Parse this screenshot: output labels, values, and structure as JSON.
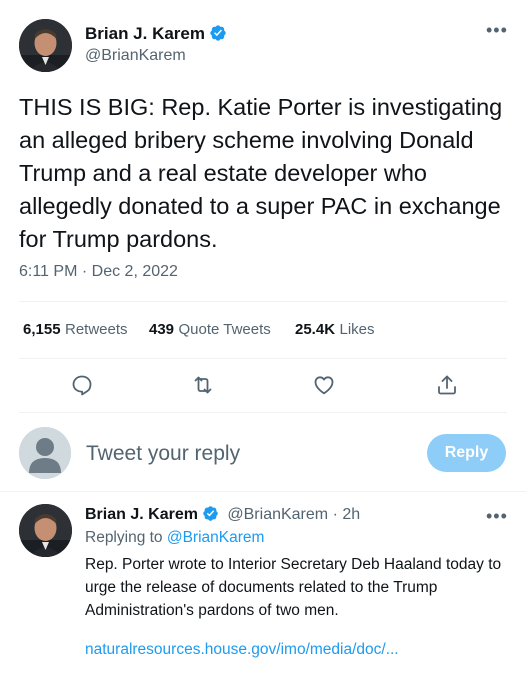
{
  "tweet": {
    "author_name": "Brian J. Karem",
    "author_handle": "@BrianKarem",
    "text": "THIS IS BIG: Rep. Katie Porter is investigating an alleged bribery scheme involving Donald Trump and a real estate developer who allegedly donated to a super PAC in exchange for Trump pardons.",
    "time": "6:11 PM",
    "separator": "·",
    "date": "Dec 2, 2022"
  },
  "stats": {
    "retweets_num": "6,155",
    "retweets_label": "Retweets",
    "quotes_num": "439",
    "quotes_label": "Quote Tweets",
    "likes_num": "25.4K",
    "likes_label": "Likes"
  },
  "actions": [
    "reply-icon",
    "retweet-icon",
    "like-icon",
    "share-icon"
  ],
  "composer": {
    "placeholder": "Tweet your reply",
    "button_label": "Reply"
  },
  "reply_tweet": {
    "author_name": "Brian J. Karem",
    "author_handle": "@BrianKarem",
    "separator": "·",
    "age": "2h",
    "replying_prefix": "Replying to",
    "replying_handle": "@BrianKarem",
    "text": "Rep. Porter wrote to Interior Secretary Deb Haaland today to urge the release of documents related to the Trump Administration's pardons of two men.",
    "link": "naturalresources.house.gov/imo/media/doc/..."
  },
  "colors": {
    "accent": "#1d9bf0",
    "reply_button": "#8ecdf8",
    "muted_text": "#536471",
    "divider": "#eff3f4"
  }
}
